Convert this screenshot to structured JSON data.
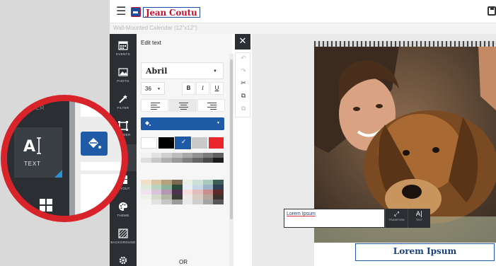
{
  "app": {
    "brand": "Jean Coutu",
    "project_title": "Wall-Mounted Calendar (12\"x12\")"
  },
  "rail": {
    "items": [
      {
        "id": "events",
        "label": "EVENTS",
        "icon": "calendar-icon"
      },
      {
        "id": "photo",
        "label": "PHOTO",
        "icon": "image-icon"
      },
      {
        "id": "filter",
        "label": "FILTER",
        "icon": "magic-wand-icon"
      },
      {
        "id": "border",
        "label": "BORDER",
        "icon": "border-icon"
      },
      {
        "id": "text",
        "label": "TEXT",
        "icon": "text-icon"
      },
      {
        "id": "layout",
        "label": "LAYOUT",
        "icon": "layout-icon"
      },
      {
        "id": "theme",
        "label": "THEME",
        "icon": "palette-icon"
      },
      {
        "id": "background",
        "label": "BACKGROUND",
        "icon": "background-icon"
      }
    ]
  },
  "panel": {
    "title": "Edit text",
    "font": "Abril",
    "size": "36",
    "bold": "B",
    "italic": "I",
    "underline": "U",
    "or_label": "OR",
    "text_color": "#1f5aa6",
    "top_swatches": [
      "#ffffff",
      "#000000",
      "#1f5aa6",
      "#c9c9c9",
      "#e8262c"
    ],
    "gray_swatches": [
      "#f2f2f2",
      "#e2e2e2",
      "#d0d0d0",
      "#bdbdbd",
      "#a8a8a8",
      "#929292",
      "#7a7a7a",
      "#5f5f5f",
      "#dedede",
      "#c8c8c8",
      "#b0b0b0",
      "#999999",
      "#808080",
      "#656565",
      "#4a4a4a",
      "#1c1c1c"
    ],
    "color_swatches": [
      "#f2e1c8",
      "#d9c3a0",
      "#b8a07e",
      "#7a6a52",
      "#e8f0e6",
      "#cfe0d7",
      "#a9c9bf",
      "#3f5d57",
      "#dfe9dc",
      "#bcd3c2",
      "#8fb09a",
      "#2d4a3d",
      "#e8eef4",
      "#c9d6e3",
      "#9cb3c9",
      "#2f3e52",
      "#efe3ef",
      "#d9c4d9",
      "#b597b5",
      "#4e3350",
      "#f5dede",
      "#e4bdbd",
      "#c98e8e",
      "#5e2a2a",
      "#eef0ea",
      "#d6dacd",
      "#b1b6a5",
      "#3b3e36",
      "#efe8e4",
      "#d8ccc5",
      "#b6a59b",
      "#3e332e",
      "#f4f4f4",
      "#e2e2e2",
      "#c6c6c6",
      "#9a9a9a",
      "#e9e9e9",
      "#cecece",
      "#a4a4a4",
      "#575757"
    ]
  },
  "canvas": {
    "calendar_text": "Lorem Ipsum",
    "edit_value": "Lorem Ipsum",
    "tools": [
      {
        "label": "TRANSFORM",
        "glyph": "⤢"
      },
      {
        "label": "TEXT",
        "glyph": "A|"
      }
    ]
  },
  "magnifier": {
    "text_label": "TEXT",
    "top_label": "DER"
  },
  "colors": {
    "rail": "#2b2f33",
    "accent": "#1f5aa6",
    "callout_ring": "#d8232a"
  }
}
